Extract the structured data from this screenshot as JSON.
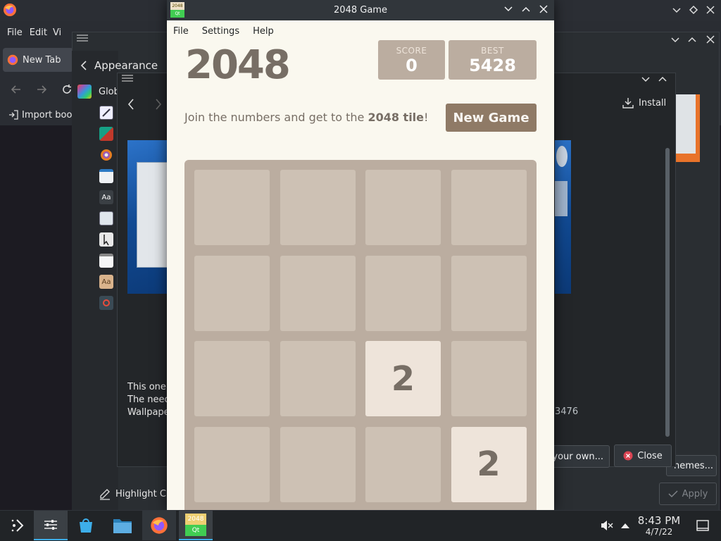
{
  "firefox": {
    "menu": [
      "File",
      "Edit",
      "Vi"
    ],
    "tab_label": "New Tab",
    "bookmarks_label": "Import boo"
  },
  "settings": {
    "back_label": "Appearance",
    "global_label": "Glob",
    "highlight_label": "Highlight Ch",
    "get_themes_label": "hemes...",
    "apply_label": "Apply"
  },
  "discover": {
    "install_label": "Install",
    "description_lines": [
      "This one's",
      "The need",
      "Wallpape"
    ],
    "count_text": "3476",
    "contribute_label": "your own...",
    "close_label": "Close"
  },
  "game_window": {
    "title": "2048 Game",
    "menu": [
      "File",
      "Settings",
      "Help"
    ],
    "game_title": "2048",
    "score_label": "SCORE",
    "score_value": "0",
    "best_label": "BEST",
    "best_value": "5428",
    "intro_prefix": "Join the numbers and get to the ",
    "intro_bold": "2048 tile",
    "intro_suffix": "!",
    "new_game_label": "New Game",
    "icon_top": "2048",
    "icon_bottom": "Qt",
    "board": [
      [
        0,
        0,
        0,
        0
      ],
      [
        0,
        0,
        0,
        0
      ],
      [
        0,
        0,
        2,
        0
      ],
      [
        0,
        0,
        0,
        2
      ]
    ]
  },
  "taskbar": {
    "time": "8:43 PM",
    "date": "4/7/22",
    "app_2048_top": "2048",
    "app_2048_bottom": "Qt"
  },
  "colors": {
    "game_bg": "#faf8ef",
    "board_bg": "#bbada0",
    "cell_bg": "#cdc1b4",
    "tile_2_bg": "#eee4da",
    "text_brown": "#776e65",
    "new_game_bg": "#8f7a66"
  }
}
